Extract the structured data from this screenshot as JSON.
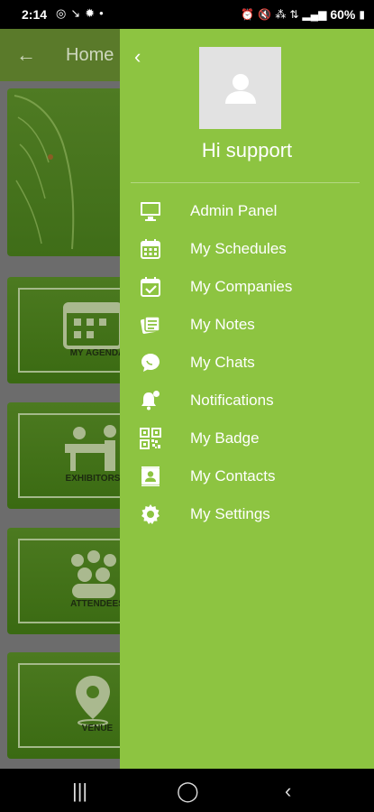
{
  "status_bar": {
    "time": "2:14",
    "battery": "60%",
    "left_icons": [
      "whatsapp-icon",
      "missed-call-icon",
      "weather-icon",
      "dot-icon"
    ],
    "right_icons": [
      "alarm-icon",
      "mute-icon",
      "volte-icon",
      "wifi-icon",
      "signal-icon",
      "battery-icon"
    ]
  },
  "app": {
    "header": {
      "title": "Home"
    },
    "tiles": [
      {
        "label": "MY AGENDA"
      },
      {
        "label": "EXHIBITORS C"
      },
      {
        "label": "ATTENDEES"
      },
      {
        "label": "VENUE"
      }
    ]
  },
  "drawer": {
    "greeting": "Hi support",
    "menu": [
      {
        "label": "Admin Panel",
        "icon": "monitor-icon"
      },
      {
        "label": "My Schedules",
        "icon": "calendar-icon"
      },
      {
        "label": "My Companies",
        "icon": "calendar-check-icon"
      },
      {
        "label": "My Notes",
        "icon": "notes-icon"
      },
      {
        "label": "My Chats",
        "icon": "chat-icon"
      },
      {
        "label": "Notifications",
        "icon": "bell-icon"
      },
      {
        "label": "My Badge",
        "icon": "qr-code-icon"
      },
      {
        "label": "My Contacts",
        "icon": "contact-card-icon"
      },
      {
        "label": "My Settings",
        "icon": "gear-icon"
      }
    ]
  },
  "colors": {
    "drawer_bg": "#8dc441",
    "scrim": "#6c6c6c",
    "text": "#ffffff"
  }
}
